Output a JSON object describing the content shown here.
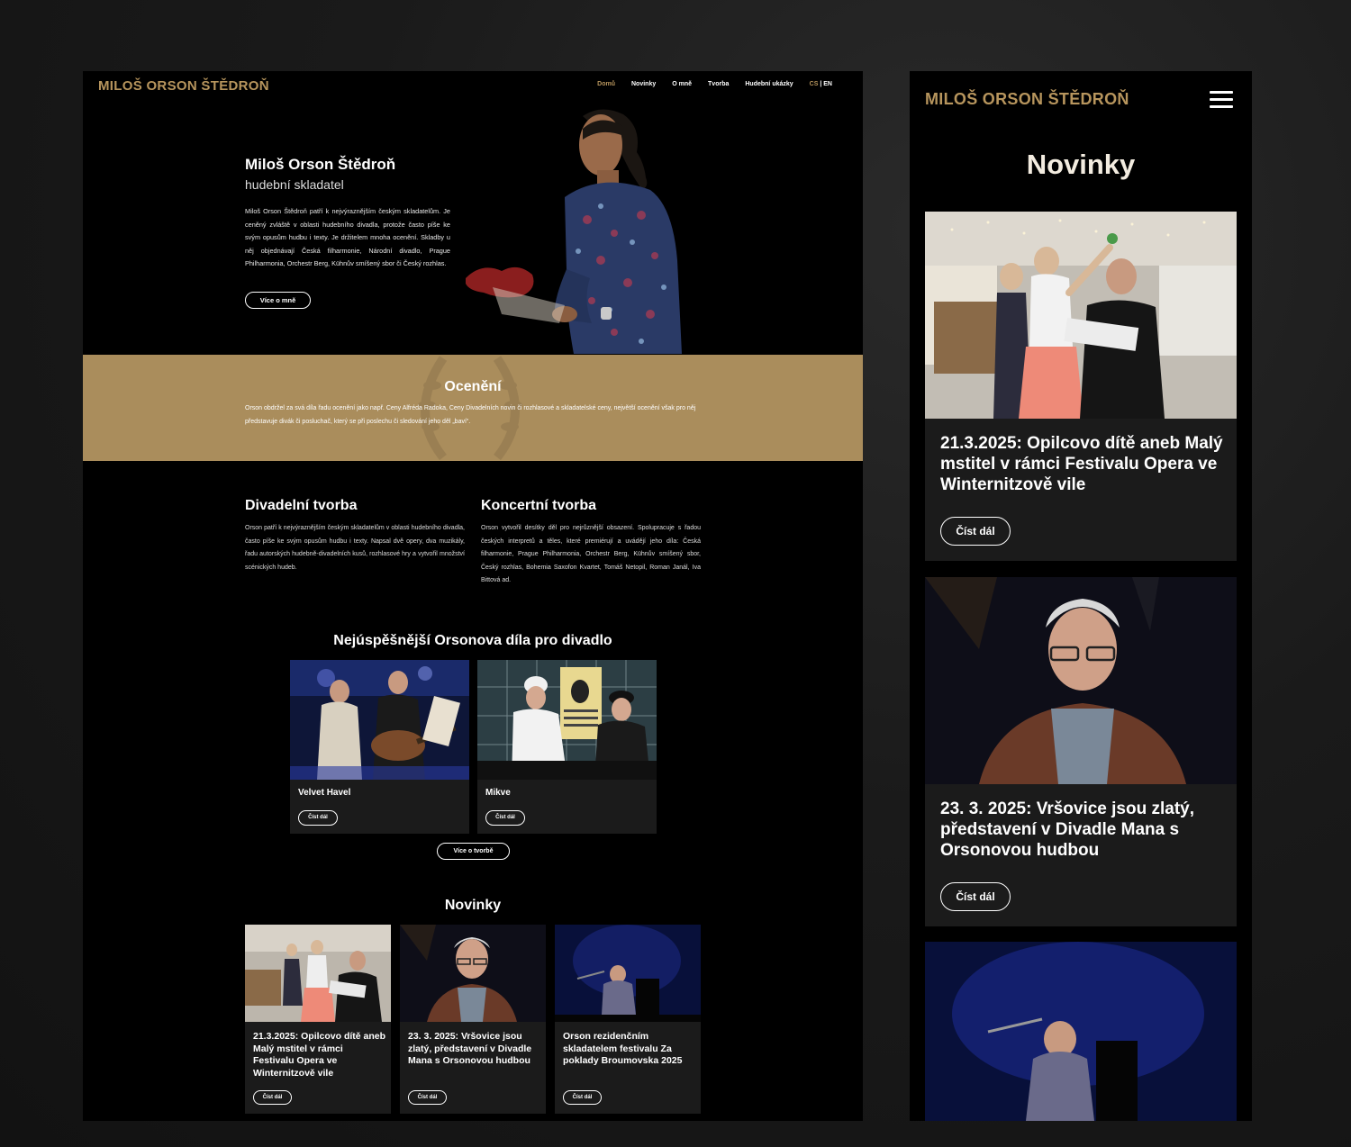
{
  "desktop": {
    "logo": "MILOŠ ORSON ŠTĚDROŇ",
    "nav": {
      "items": [
        "Domů",
        "Novinky",
        "O mně",
        "Tvorba",
        "Hudební ukázky"
      ],
      "active_index": 0,
      "lang_cs": "CS",
      "lang_sep": " | ",
      "lang_en": "EN"
    },
    "hero": {
      "name": "Miloš Orson Štědroň",
      "role": "hudební skladatel",
      "text": "Miloš Orson Štědroň patří k nejvýraznějším českým skladatelům. Je ceněný zvláště v oblasti hudebního divadla, protože často píše ke svým opusům hudbu i texty. Je držitelem mnoha ocenění. Skladby u něj objednávají Česká filharmonie, Národní divadlo, Prague Philharmonia, Orchestr Berg, Kühnův smíšený sbor či Český rozhlas.",
      "button": "Více o mně"
    },
    "award": {
      "title": "Ocenění",
      "text": "Orson obdržel za svá díla řadu ocenění jako např. Ceny Alfréda Radoka, Ceny Divadelních novin či rozhlasové a skladatelské ceny, největší ocenění však pro něj představuje divák či posluchač, který se při poslechu či sledování jeho děl „baví“."
    },
    "columns": [
      {
        "title": "Divadelní tvorba",
        "text": "Orson patří k nejvýraznějším českým skladatelům v oblasti hudebního divadla, často píše ke svým opusům hudbu i texty. Napsal dvě opery, dva muzikály, řadu autorských hudebně-divadelních kusů, rozhlasové hry a vytvořil množství scénických hudeb."
      },
      {
        "title": "Koncertní tvorba",
        "text": "Orson vytvořil desítky děl pro nejrůznější obsazení. Spolupracuje s řadou českých interpretů a těles, které premiérují a uvádějí jeho díla: Česká filharmonie, Prague Philharmonia, Orchestr Berg, Kühnův smíšený sbor, Český rozhlas, Bohemia Saxofon Kvartet, Tomáš Netopil, Roman Janál, Iva Bittová ad."
      }
    ],
    "works": {
      "title": "Nejúspěšnější Orsonova díla pro divadlo",
      "items": [
        {
          "title": "Velvet Havel",
          "button": "Číst dál"
        },
        {
          "title": "Mikve",
          "button": "Číst dál"
        }
      ],
      "more_button": "Více o tvorbě"
    },
    "news": {
      "title": "Novinky",
      "items": [
        {
          "title": "21.3.2025: Opilcovo dítě aneb Malý mstitel v rámci Festivalu Opera ve Winternitzově vile",
          "button": "Číst dál"
        },
        {
          "title": "23. 3. 2025: Vršovice jsou zlatý, představení v Divadle Mana s Orsonovou hudbou",
          "button": "Číst dál"
        },
        {
          "title": "Orson rezidenčním skladatelem festivalu Za poklady Broumovska 2025",
          "button": "Číst dál"
        }
      ]
    }
  },
  "mobile": {
    "logo": "MILOŠ ORSON ŠTĚDROŇ",
    "menu_icon": "hamburger-icon",
    "title": "Novinky",
    "items": [
      {
        "title": "21.3.2025: Opilcovo dítě aneb Malý mstitel v rámci Festivalu Opera ve Winternitzově vile",
        "button": "Číst dál"
      },
      {
        "title": "23. 3. 2025: Vršovice jsou zlatý, představení v Divadle Mana s Orsonovou hudbou",
        "button": "Číst dál"
      }
    ]
  },
  "colors": {
    "accent_gold": "#b7955d",
    "award_band": "#aa8d5c",
    "card_bg": "#1b1b1b",
    "page_bg": "#000000"
  }
}
